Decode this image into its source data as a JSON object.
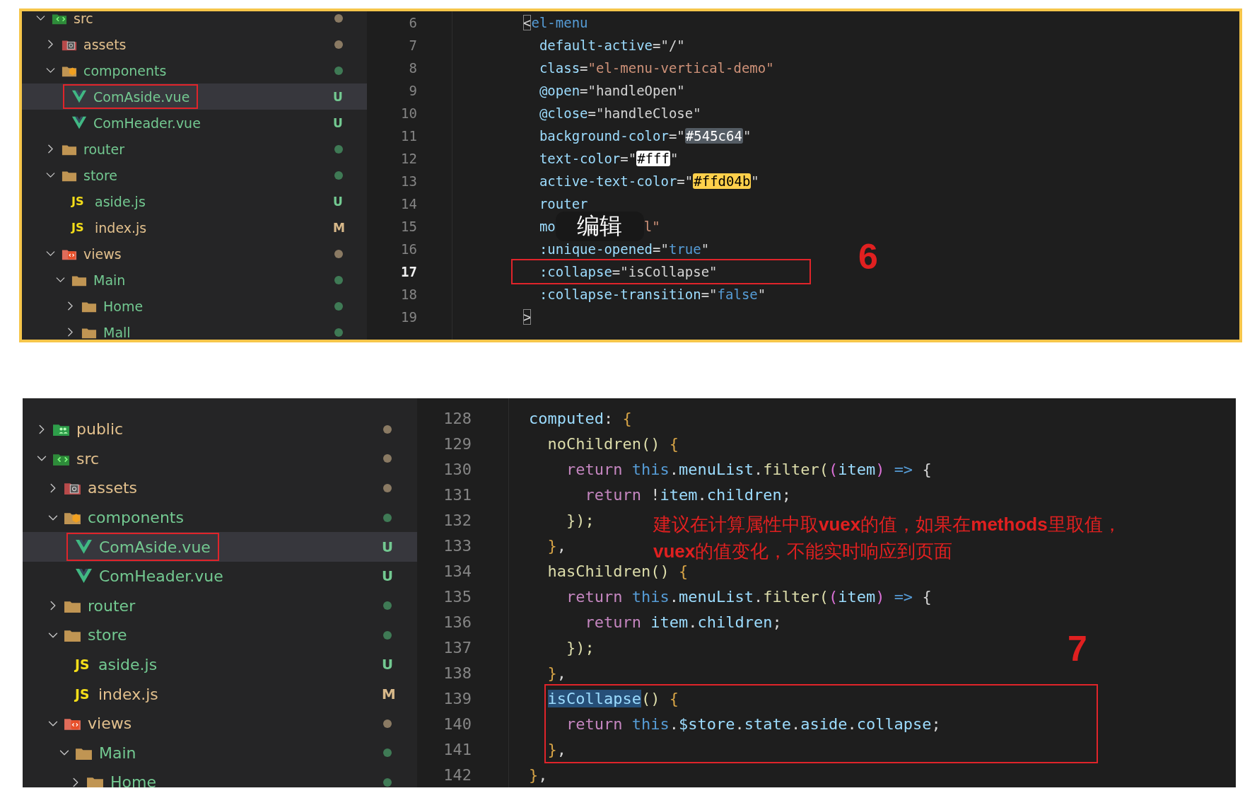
{
  "panels": [
    {
      "framed": true,
      "marker": "6",
      "tree": [
        {
          "name": "src",
          "kind": "source",
          "modified": true,
          "ignored": false,
          "expanded": true,
          "selected": false,
          "outlined": false,
          "children": [
            {
              "name": "assets",
              "kind": "assets",
              "modified": true,
              "ignored": false,
              "expanded": false,
              "selected": false,
              "outlined": false
            },
            {
              "name": "components",
              "kind": "components",
              "modified": false,
              "ignored": false,
              "expanded": true,
              "selected": false,
              "outlined": false,
              "children": [
                {
                  "name": "ComAside.vue",
                  "kind": "vue",
                  "modified": false,
                  "ignored": false,
                  "badge": "U",
                  "selected": true,
                  "outlined": true
                },
                {
                  "name": "ComHeader.vue",
                  "kind": "vue",
                  "modified": false,
                  "ignored": false,
                  "badge": "U",
                  "selected": false,
                  "outlined": false
                }
              ]
            },
            {
              "name": "router",
              "kind": "folder",
              "modified": false,
              "ignored": false,
              "expanded": false,
              "selected": false,
              "outlined": false
            },
            {
              "name": "store",
              "kind": "folder",
              "modified": false,
              "ignored": false,
              "expanded": true,
              "selected": false,
              "outlined": false,
              "children": [
                {
                  "name": "aside.js",
                  "kind": "js",
                  "icon_label": "JS",
                  "modified": false,
                  "ignored": false,
                  "badge": "U",
                  "selected": false,
                  "outlined": false
                },
                {
                  "name": "index.js",
                  "kind": "js",
                  "icon_label": "JS",
                  "modified": true,
                  "ignored": false,
                  "badge": "M",
                  "selected": false,
                  "outlined": false
                }
              ]
            },
            {
              "name": "views",
              "kind": "views",
              "modified": true,
              "ignored": false,
              "expanded": true,
              "selected": false,
              "outlined": false,
              "children": [
                {
                  "name": "Main",
                  "kind": "folder",
                  "modified": false,
                  "ignored": false,
                  "expanded": true,
                  "selected": false,
                  "outlined": false,
                  "children": [
                    {
                      "name": "Home",
                      "kind": "folder",
                      "modified": false,
                      "ignored": false,
                      "expanded": false,
                      "selected": false,
                      "outlined": false
                    },
                    {
                      "name": "Mall",
                      "kind": "folder",
                      "modified": false,
                      "ignored": false,
                      "expanded": false,
                      "selected": false,
                      "outlined": false
                    }
                  ]
                }
              ]
            }
          ]
        }
      ],
      "lines": [
        {
          "n": "6",
          "current": false,
          "boxed": false,
          "tokens": [
            {
              "t": "<",
              "kind": "match"
            },
            {
              "t": "el-menu",
              "kind": "tag"
            }
          ]
        },
        {
          "n": "7",
          "current": false,
          "boxed": false,
          "tokens": [
            {
              "t": "  default-active",
              "kind": "attr"
            },
            {
              "t": "=\"/\"",
              "kind": "plain"
            }
          ]
        },
        {
          "n": "8",
          "current": false,
          "boxed": false,
          "tokens": [
            {
              "t": "  class",
              "kind": "attr"
            },
            {
              "t": "=",
              "kind": "plain"
            },
            {
              "t": "\"el-menu-vertical-demo\"",
              "kind": "str"
            }
          ]
        },
        {
          "n": "9",
          "current": false,
          "boxed": false,
          "tokens": [
            {
              "t": "  @open",
              "kind": "attr"
            },
            {
              "t": "=\"handleOpen\"",
              "kind": "plain"
            }
          ]
        },
        {
          "n": "10",
          "current": false,
          "boxed": false,
          "tokens": [
            {
              "t": "  @close",
              "kind": "attr"
            },
            {
              "t": "=\"handleClose\"",
              "kind": "plain"
            }
          ]
        },
        {
          "n": "11",
          "current": false,
          "boxed": false,
          "tokens": [
            {
              "t": "  background-color",
              "kind": "attr"
            },
            {
              "t": "=\"",
              "kind": "plain"
            },
            {
              "t": "#545c64",
              "kind": "chip",
              "color": "#545c64"
            },
            {
              "t": "\"",
              "kind": "plain"
            }
          ]
        },
        {
          "n": "12",
          "current": false,
          "boxed": false,
          "tokens": [
            {
              "t": "  text-color",
              "kind": "attr"
            },
            {
              "t": "=\"",
              "kind": "plain"
            },
            {
              "t": "#fff",
              "kind": "chip",
              "color": "#ffffff"
            },
            {
              "t": "\"",
              "kind": "plain"
            }
          ]
        },
        {
          "n": "13",
          "current": false,
          "boxed": false,
          "tokens": [
            {
              "t": "  active-text-color",
              "kind": "attr"
            },
            {
              "t": "=\"",
              "kind": "plain"
            },
            {
              "t": "#ffd04b",
              "kind": "chip",
              "color": "#ffd04b"
            },
            {
              "t": "\"",
              "kind": "plain"
            }
          ]
        },
        {
          "n": "14",
          "current": false,
          "boxed": false,
          "tokens": [
            {
              "t": "  router",
              "kind": "attr"
            }
          ]
        },
        {
          "n": "15",
          "current": false,
          "boxed": false,
          "tokens": [
            {
              "t": "  mo",
              "kind": "attr"
            }
          ],
          "overlay": "编辑",
          "after": [
            {
              "t": "l\"",
              "kind": "str"
            }
          ]
        },
        {
          "n": "16",
          "current": false,
          "boxed": false,
          "tokens": [
            {
              "t": "  :unique-opened",
              "kind": "attr"
            },
            {
              "t": "=\"",
              "kind": "plain"
            },
            {
              "t": "true",
              "kind": "const"
            },
            {
              "t": "\"",
              "kind": "plain"
            }
          ]
        },
        {
          "n": "17",
          "current": true,
          "boxed": true,
          "tokens": [
            {
              "t": "  :collapse",
              "kind": "attr"
            },
            {
              "t": "=\"isCollapse\"",
              "kind": "plain"
            }
          ]
        },
        {
          "n": "18",
          "current": false,
          "boxed": false,
          "tokens": [
            {
              "t": "  :collapse-transition",
              "kind": "attr"
            },
            {
              "t": "=\"",
              "kind": "plain"
            },
            {
              "t": "false",
              "kind": "const"
            },
            {
              "t": "\"",
              "kind": "plain"
            }
          ]
        },
        {
          "n": "19",
          "current": false,
          "boxed": false,
          "tokens": [
            {
              "t": ">",
              "kind": "match"
            }
          ]
        }
      ]
    },
    {
      "framed": false,
      "marker": "7",
      "tree": [
        {
          "name": "public",
          "kind": "public",
          "modified": true,
          "ignored": false,
          "expanded": false,
          "selected": false,
          "outlined": false
        },
        {
          "name": "src",
          "kind": "source",
          "modified": true,
          "ignored": false,
          "expanded": true,
          "selected": false,
          "outlined": false,
          "children": [
            {
              "name": "assets",
              "kind": "assets",
              "modified": true,
              "ignored": false,
              "expanded": false,
              "selected": false,
              "outlined": false
            },
            {
              "name": "components",
              "kind": "components",
              "modified": false,
              "ignored": false,
              "expanded": true,
              "selected": false,
              "outlined": false,
              "children": [
                {
                  "name": "ComAside.vue",
                  "kind": "vue",
                  "modified": false,
                  "ignored": false,
                  "badge": "U",
                  "selected": true,
                  "outlined": true
                },
                {
                  "name": "ComHeader.vue",
                  "kind": "vue",
                  "modified": false,
                  "ignored": false,
                  "badge": "U",
                  "selected": false,
                  "outlined": false
                }
              ]
            },
            {
              "name": "router",
              "kind": "folder",
              "modified": false,
              "ignored": false,
              "expanded": false,
              "selected": false,
              "outlined": false
            },
            {
              "name": "store",
              "kind": "folder",
              "modified": false,
              "ignored": false,
              "expanded": true,
              "selected": false,
              "outlined": false,
              "children": [
                {
                  "name": "aside.js",
                  "kind": "js",
                  "icon_label": "JS",
                  "modified": false,
                  "ignored": false,
                  "badge": "U",
                  "selected": false,
                  "outlined": false
                },
                {
                  "name": "index.js",
                  "kind": "js",
                  "icon_label": "JS",
                  "modified": true,
                  "ignored": false,
                  "badge": "M",
                  "selected": false,
                  "outlined": false
                }
              ]
            },
            {
              "name": "views",
              "kind": "views",
              "modified": true,
              "ignored": false,
              "expanded": true,
              "selected": false,
              "outlined": false,
              "children": [
                {
                  "name": "Main",
                  "kind": "folder",
                  "modified": false,
                  "ignored": false,
                  "expanded": true,
                  "selected": false,
                  "outlined": false,
                  "children": [
                    {
                      "name": "Home",
                      "kind": "folder",
                      "modified": false,
                      "ignored": false,
                      "expanded": false,
                      "selected": false,
                      "outlined": false
                    }
                  ]
                }
              ]
            }
          ]
        }
      ],
      "lines": [
        {
          "n": "128",
          "current": false,
          "boxed": false,
          "tokens": [
            {
              "t": "computed",
              "kind": "var"
            },
            {
              "t": ": ",
              "kind": "plain"
            },
            {
              "t": "{",
              "kind": "brace"
            }
          ]
        },
        {
          "n": "129",
          "current": false,
          "boxed": false,
          "tokens": [
            {
              "t": "  noChildren()",
              "kind": "fn"
            },
            {
              "t": " {",
              "kind": "brace"
            }
          ]
        },
        {
          "n": "130",
          "current": false,
          "boxed": false,
          "tokens": [
            {
              "t": "    return ",
              "kind": "kw"
            },
            {
              "t": "this",
              "kind": "const"
            },
            {
              "t": ".",
              "kind": "plain"
            },
            {
              "t": "menuList",
              "kind": "var"
            },
            {
              "t": ".",
              "kind": "plain"
            },
            {
              "t": "filter",
              "kind": "fn"
            },
            {
              "t": "(",
              "kind": "fn"
            },
            {
              "t": "(",
              "kind": "paren"
            },
            {
              "t": "item",
              "kind": "var"
            },
            {
              "t": ")",
              "kind": "paren"
            },
            {
              "t": " => ",
              "kind": "const"
            },
            {
              "t": "{",
              "kind": "plain"
            }
          ]
        },
        {
          "n": "131",
          "current": false,
          "boxed": false,
          "tokens": [
            {
              "t": "      return ",
              "kind": "kw"
            },
            {
              "t": "!",
              "kind": "plain"
            },
            {
              "t": "item",
              "kind": "var"
            },
            {
              "t": ".",
              "kind": "plain"
            },
            {
              "t": "children",
              "kind": "var"
            },
            {
              "t": ";",
              "kind": "plain"
            }
          ]
        },
        {
          "n": "132",
          "current": false,
          "boxed": false,
          "tokens": [
            {
              "t": "    });",
              "kind": "fn"
            }
          ]
        },
        {
          "n": "133",
          "current": false,
          "boxed": false,
          "tokens": [
            {
              "t": "  }",
              "kind": "brace"
            },
            {
              "t": ",",
              "kind": "plain"
            }
          ]
        },
        {
          "n": "134",
          "current": false,
          "boxed": false,
          "tokens": [
            {
              "t": "  hasChildren()",
              "kind": "fn"
            },
            {
              "t": " {",
              "kind": "brace"
            }
          ]
        },
        {
          "n": "135",
          "current": false,
          "boxed": false,
          "tokens": [
            {
              "t": "    return ",
              "kind": "kw"
            },
            {
              "t": "this",
              "kind": "const"
            },
            {
              "t": ".",
              "kind": "plain"
            },
            {
              "t": "menuList",
              "kind": "var"
            },
            {
              "t": ".",
              "kind": "plain"
            },
            {
              "t": "filter",
              "kind": "fn"
            },
            {
              "t": "(",
              "kind": "fn"
            },
            {
              "t": "(",
              "kind": "paren"
            },
            {
              "t": "item",
              "kind": "var"
            },
            {
              "t": ")",
              "kind": "paren"
            },
            {
              "t": " => ",
              "kind": "const"
            },
            {
              "t": "{",
              "kind": "plain"
            }
          ]
        },
        {
          "n": "136",
          "current": false,
          "boxed": false,
          "tokens": [
            {
              "t": "      return ",
              "kind": "kw"
            },
            {
              "t": "item",
              "kind": "var"
            },
            {
              "t": ".",
              "kind": "plain"
            },
            {
              "t": "children",
              "kind": "var"
            },
            {
              "t": ";",
              "kind": "plain"
            }
          ]
        },
        {
          "n": "137",
          "current": false,
          "boxed": false,
          "tokens": [
            {
              "t": "    });",
              "kind": "fn"
            }
          ]
        },
        {
          "n": "138",
          "current": false,
          "boxed": false,
          "tokens": [
            {
              "t": "  }",
              "kind": "brace"
            },
            {
              "t": ",",
              "kind": "plain"
            }
          ]
        },
        {
          "n": "139",
          "current": false,
          "boxed": true,
          "tokens": [
            {
              "t": "  isCollapse",
              "kind": "selection"
            },
            {
              "t": "()",
              "kind": "fn"
            },
            {
              "t": " {",
              "kind": "brace"
            }
          ]
        },
        {
          "n": "140",
          "current": false,
          "boxed": true,
          "tokens": [
            {
              "t": "    return ",
              "kind": "kw"
            },
            {
              "t": "this",
              "kind": "const"
            },
            {
              "t": ".",
              "kind": "plain"
            },
            {
              "t": "$store",
              "kind": "var"
            },
            {
              "t": ".",
              "kind": "plain"
            },
            {
              "t": "state",
              "kind": "var"
            },
            {
              "t": ".",
              "kind": "plain"
            },
            {
              "t": "aside",
              "kind": "var"
            },
            {
              "t": ".",
              "kind": "plain"
            },
            {
              "t": "collapse",
              "kind": "var"
            },
            {
              "t": ";",
              "kind": "plain"
            }
          ]
        },
        {
          "n": "141",
          "current": false,
          "boxed": true,
          "tokens": [
            {
              "t": "  }",
              "kind": "brace"
            },
            {
              "t": ",",
              "kind": "plain"
            }
          ]
        },
        {
          "n": "142",
          "current": false,
          "boxed": false,
          "tokens": [
            {
              "t": "}",
              "kind": "brace"
            },
            {
              "t": ",",
              "kind": "plain"
            }
          ]
        }
      ],
      "note": [
        "建议在计算属性中取**vuex**的值，如果在**methods**里取值，",
        "**vuex**的值变化，不能实时响应到页面"
      ]
    }
  ]
}
